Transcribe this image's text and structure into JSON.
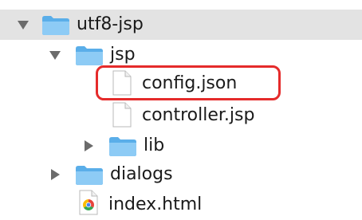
{
  "tree": {
    "items": [
      {
        "label": "utf8-jsp",
        "type": "folder",
        "expanded": true,
        "selected": true,
        "icon": "folder-icon"
      },
      {
        "label": "jsp",
        "type": "folder",
        "expanded": true,
        "icon": "folder-icon"
      },
      {
        "label": "config.json",
        "type": "file",
        "icon": "document-icon",
        "highlighted": true
      },
      {
        "label": "controller.jsp",
        "type": "file",
        "icon": "document-icon"
      },
      {
        "label": "lib",
        "type": "folder",
        "expanded": false,
        "icon": "folder-icon"
      },
      {
        "label": "dialogs",
        "type": "folder",
        "expanded": false,
        "icon": "folder-icon"
      },
      {
        "label": "index.html",
        "type": "file",
        "icon": "chrome-icon"
      }
    ]
  },
  "colors": {
    "selection": "#e3e3e3",
    "folder_blue": "#6ab7ef",
    "highlight_border": "#e52b2b"
  }
}
